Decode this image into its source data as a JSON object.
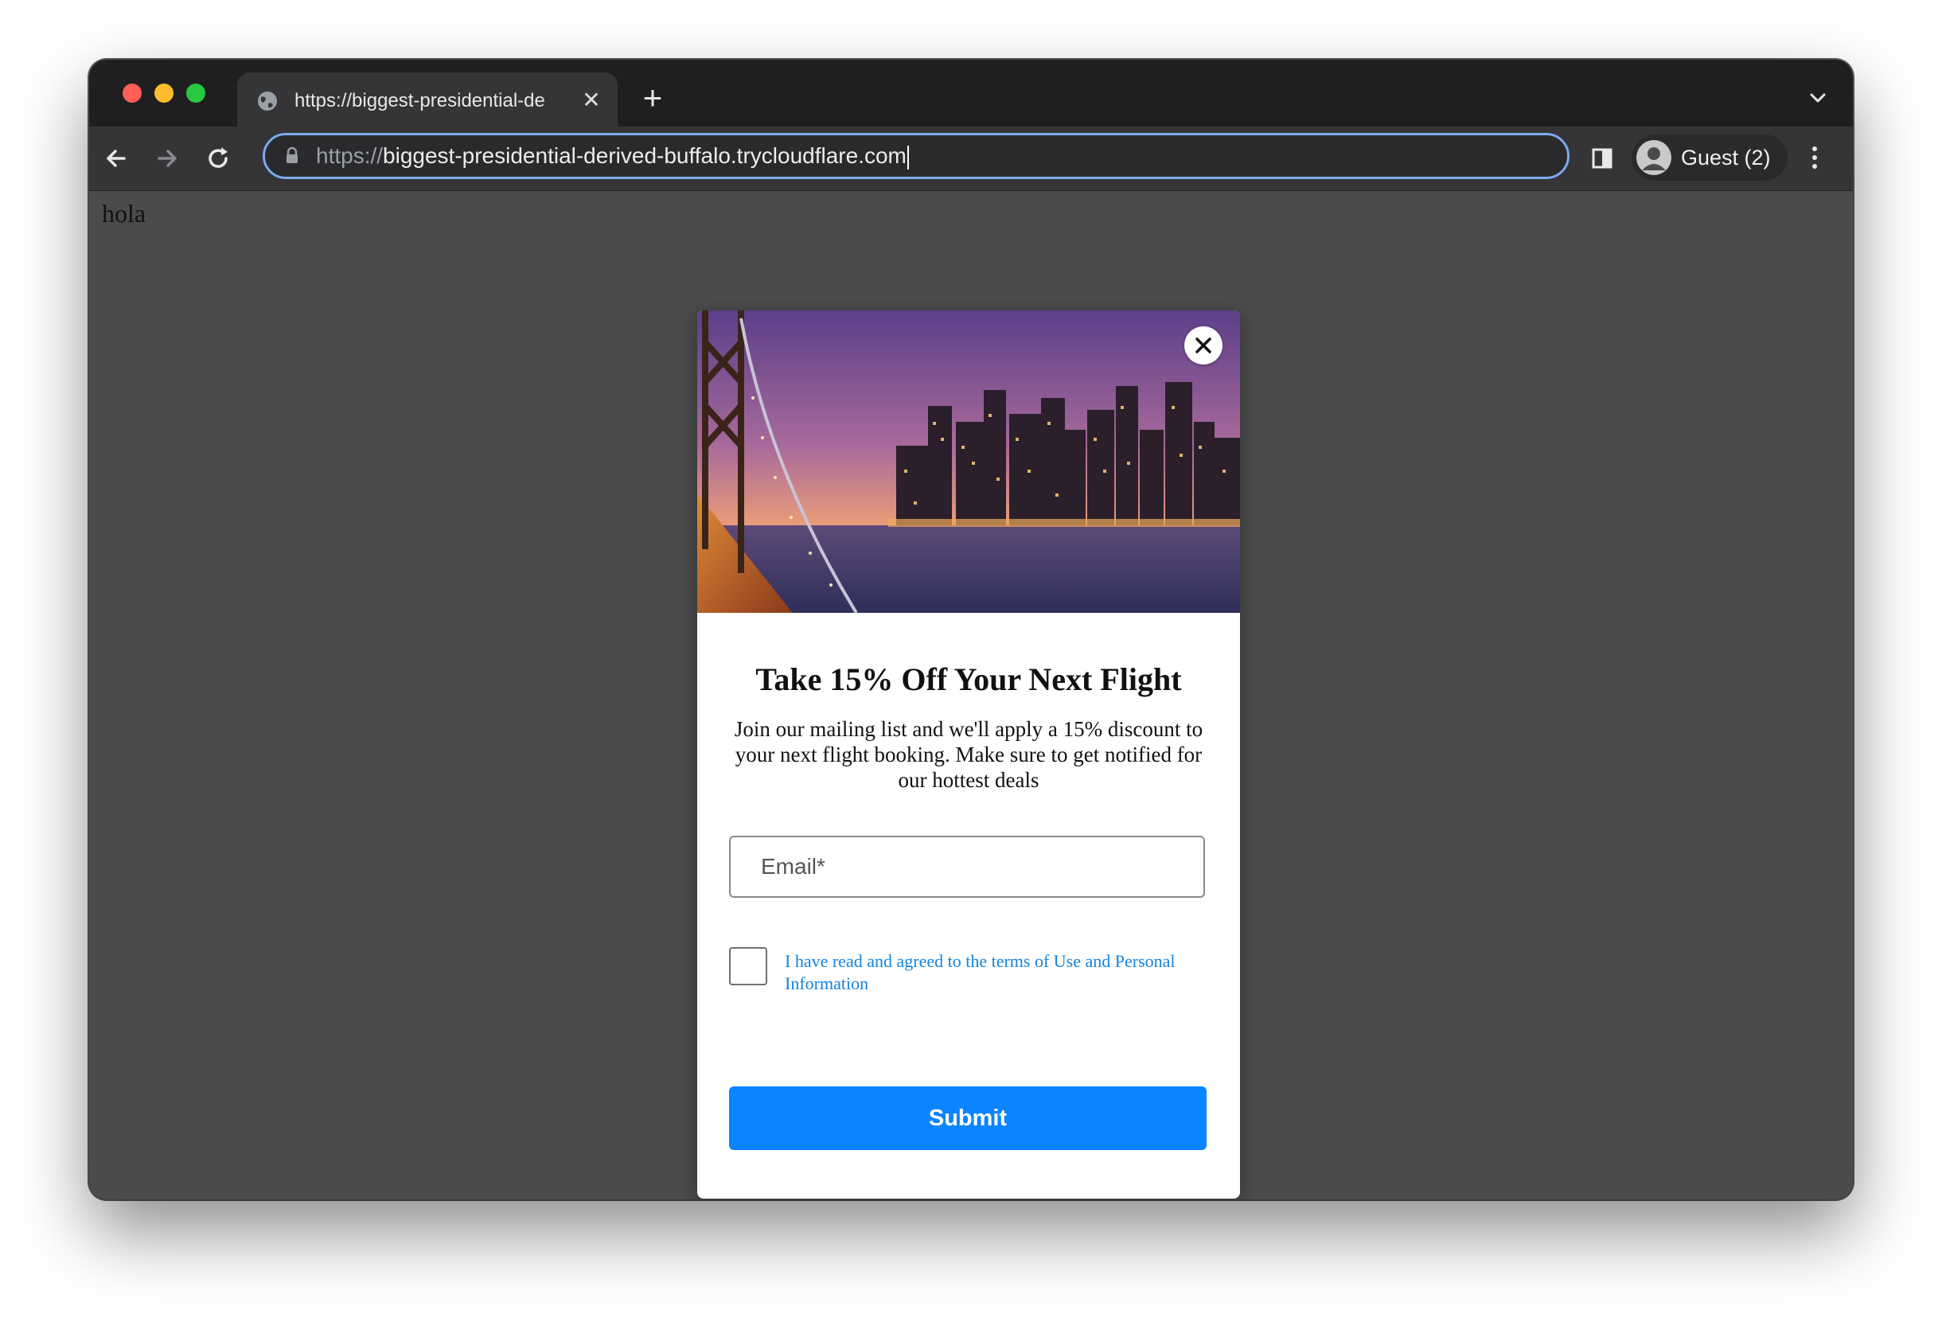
{
  "browser": {
    "tab": {
      "title": "https://biggest-presidential-de",
      "favicon_icon": "globe-icon",
      "close_icon": "close-icon"
    },
    "new_tab_icon": "plus-icon",
    "tab_search_icon": "chevron-down-icon",
    "toolbar": {
      "back_icon": "arrow-left-icon",
      "forward_icon": "arrow-right-icon",
      "reload_icon": "reload-icon",
      "side_panel_icon": "side-panel-icon",
      "menu_icon": "more-vertical-icon"
    },
    "address_bar": {
      "lock_icon": "lock-icon",
      "scheme": "https://",
      "host": "biggest-presidential-derived-buffalo.trycloudflare.com"
    },
    "profile": {
      "label": "Guest (2)",
      "avatar_icon": "person-icon"
    }
  },
  "page": {
    "text": "hola"
  },
  "popup": {
    "hero_image": "city-skyline-at-dusk-with-bridge",
    "close_icon": "close-icon",
    "title": "Take 15% Off Your Next Flight",
    "description": "Join our mailing list and we'll apply a 15% discount to your next flight booking. Make sure to get notified for our hottest deals",
    "email_placeholder": "Email*",
    "consent_label": "I have read and agreed to the terms of Use and Personal Information",
    "consent_checked": false,
    "submit_label": "Submit"
  },
  "colors": {
    "accent_blue": "#0a84ff",
    "link_blue": "#1284e0",
    "chrome_dark": "#1f1f21",
    "toolbar_dark": "#353538",
    "page_background": "#4b4b4b",
    "omnibox_focus": "#7ba9ec"
  }
}
